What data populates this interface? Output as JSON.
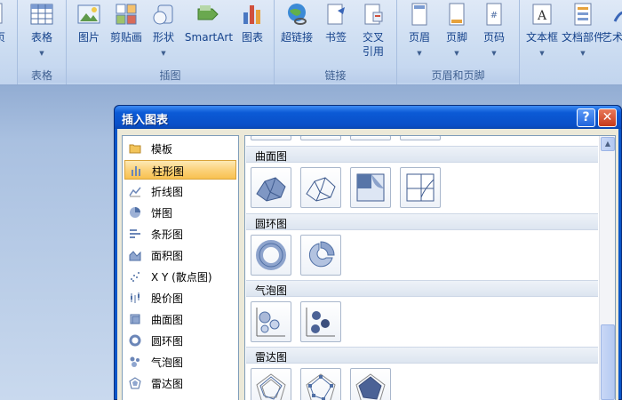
{
  "ribbon": {
    "groups": {
      "tables": "表格",
      "illustrations": "插图",
      "links": "链接",
      "header_footer": "页眉和页脚"
    },
    "buttons": {
      "page_fragment": "页",
      "table": "表格",
      "picture": "图片",
      "clipart": "剪贴画",
      "shapes": "形状",
      "smartart": "SmartArt",
      "chart": "图表",
      "hyperlink": "超链接",
      "bookmark": "书签",
      "cross_ref_line1": "交叉",
      "cross_ref_line2": "引用",
      "header": "页眉",
      "footer": "页脚",
      "page_number": "页码",
      "textbox": "文本框",
      "quick_parts": "文档部件",
      "wordart": "艺术"
    }
  },
  "dialog": {
    "title": "插入图表",
    "help_symbol": "?",
    "close_symbol": "✕",
    "categories": [
      {
        "label": "模板",
        "icon": "folder-icon"
      },
      {
        "label": "柱形图",
        "icon": "column-chart-icon"
      },
      {
        "label": "折线图",
        "icon": "line-chart-icon"
      },
      {
        "label": "饼图",
        "icon": "pie-chart-icon"
      },
      {
        "label": "条形图",
        "icon": "bar-chart-icon"
      },
      {
        "label": "面积图",
        "icon": "area-chart-icon"
      },
      {
        "label": "X Y (散点图)",
        "icon": "scatter-chart-icon"
      },
      {
        "label": "股价图",
        "icon": "stock-chart-icon"
      },
      {
        "label": "曲面图",
        "icon": "surface-chart-icon"
      },
      {
        "label": "圆环图",
        "icon": "doughnut-chart-icon"
      },
      {
        "label": "气泡图",
        "icon": "bubble-chart-icon"
      },
      {
        "label": "雷达图",
        "icon": "radar-chart-icon"
      }
    ],
    "selected_category": "柱形图",
    "sections": {
      "surface": "曲面图",
      "doughnut": "圆环图",
      "bubble": "气泡图",
      "radar": "雷达图"
    },
    "scroll_up_symbol": "▲"
  },
  "colors": {
    "dialog_frame": "#0a56c8",
    "selection": "#fbd27c",
    "ribbon": "#cbdcf1"
  }
}
